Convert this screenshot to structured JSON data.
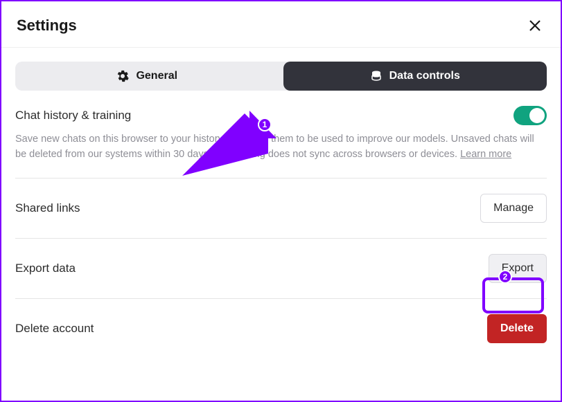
{
  "title": "Settings",
  "tabs": {
    "general": "General",
    "data_controls": "Data controls"
  },
  "sections": {
    "history": {
      "label": "Chat history & training",
      "desc_a": "Save new chats on this browser to your history and allow them to be used to improve our models. Unsaved chats will be deleted from our systems within 30 days. This setting does not sync across browsers or devices. ",
      "learn_more": "Learn more",
      "toggle_on": true
    },
    "shared_links": {
      "label": "Shared links",
      "button": "Manage"
    },
    "export_data": {
      "label": "Export data",
      "button": "Export"
    },
    "delete_account": {
      "label": "Delete account",
      "button": "Delete"
    }
  },
  "annotations": {
    "step1": "1",
    "step2": "2"
  }
}
